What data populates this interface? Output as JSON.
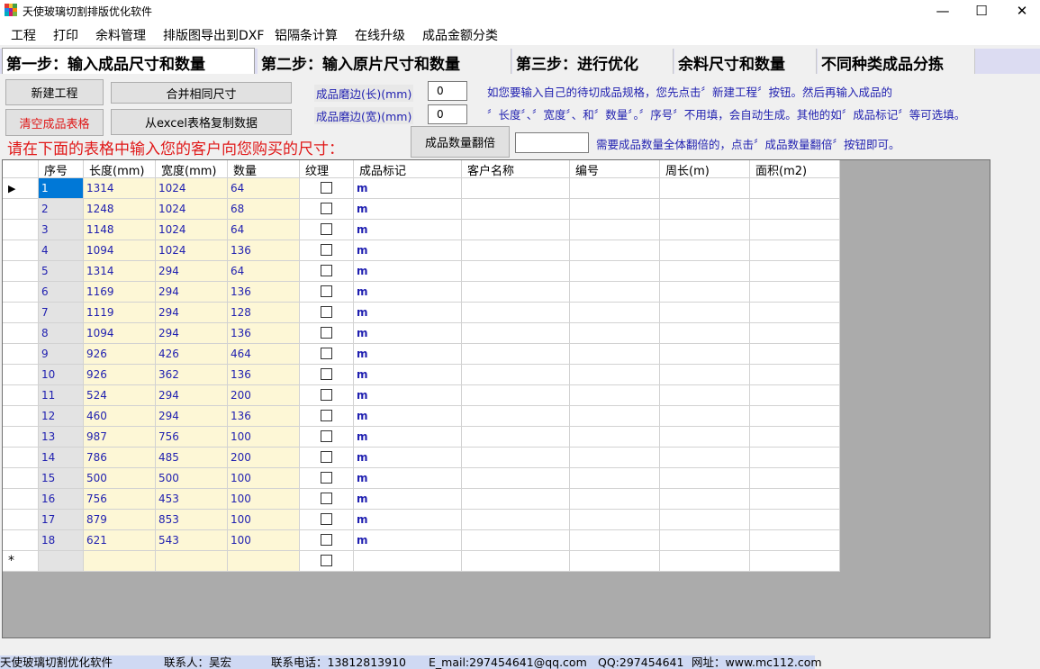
{
  "window": {
    "title": "天使玻璃切割排版优化软件",
    "minimize": "—",
    "maximize": "☐",
    "close": "✕"
  },
  "menu": [
    "工程",
    "打印",
    "余料管理",
    "排版图导出到DXF",
    "铝隔条计算",
    "在线升级",
    "成品金额分类"
  ],
  "tabs": [
    "第一步：输入成品尺寸和数量",
    "第二步：输入原片尺寸和数量",
    "第三步：进行优化",
    "余料尺寸和数量",
    "不同种类成品分拣"
  ],
  "toolbar": {
    "new_project": "新建工程",
    "merge_same": "合并相同尺寸",
    "clear_table": "清空成品表格",
    "copy_excel": "从excel表格复制数据",
    "edge_len_label": "成品磨边(长)(mm)",
    "edge_len_value": "0",
    "edge_wid_label": "成品磨边(宽)(mm)",
    "edge_wid_value": "0",
    "multiply_button": "成品数量翻倍",
    "multiply_value": ""
  },
  "instructions": {
    "line1": "如您要输入自己的待切成品规格，您先点击〞新建工程〞按钮。然后再输入成品的",
    "line2": "〞长度〞、〞宽度〞、和〞数量〞。〞序号〞不用填，会自动生成。其他的如〞成品标记〞等可选填。",
    "multiply_hint": "需要成品数量全体翻倍的，点击〞成品数量翻倍〞按钮即可。",
    "red_prompt": "请在下面的表格中输入您的客户向您购买的尺寸："
  },
  "colors": {
    "selected_cell": "#0078d7",
    "input_column_bg": "#fdf7d6",
    "index_column_bg": "#e3e3e3",
    "blue_text": "#1f1fb0",
    "red_text": "#e01818",
    "status_bg": "#cfd9f3"
  },
  "table": {
    "columns": [
      "序号",
      "长度(mm)",
      "宽度(mm)",
      "数量",
      "纹理",
      "成品标记",
      "客户名称",
      "编号",
      "周长(m)",
      "面积(m2)"
    ],
    "current_row_indicator": "▶",
    "new_row_indicator": "*",
    "rows": [
      {
        "idx": "1",
        "len": "1314",
        "wid": "1024",
        "qty": "64",
        "mark": "m"
      },
      {
        "idx": "2",
        "len": "1248",
        "wid": "1024",
        "qty": "68",
        "mark": "m"
      },
      {
        "idx": "3",
        "len": "1148",
        "wid": "1024",
        "qty": "64",
        "mark": "m"
      },
      {
        "idx": "4",
        "len": "1094",
        "wid": "1024",
        "qty": "136",
        "mark": "m"
      },
      {
        "idx": "5",
        "len": "1314",
        "wid": "294",
        "qty": "64",
        "mark": "m"
      },
      {
        "idx": "6",
        "len": "1169",
        "wid": "294",
        "qty": "136",
        "mark": "m"
      },
      {
        "idx": "7",
        "len": "1119",
        "wid": "294",
        "qty": "128",
        "mark": "m"
      },
      {
        "idx": "8",
        "len": "1094",
        "wid": "294",
        "qty": "136",
        "mark": "m"
      },
      {
        "idx": "9",
        "len": "926",
        "wid": "426",
        "qty": "464",
        "mark": "m"
      },
      {
        "idx": "10",
        "len": "926",
        "wid": "362",
        "qty": "136",
        "mark": "m"
      },
      {
        "idx": "11",
        "len": "524",
        "wid": "294",
        "qty": "200",
        "mark": "m"
      },
      {
        "idx": "12",
        "len": "460",
        "wid": "294",
        "qty": "136",
        "mark": "m"
      },
      {
        "idx": "13",
        "len": "987",
        "wid": "756",
        "qty": "100",
        "mark": "m"
      },
      {
        "idx": "14",
        "len": "786",
        "wid": "485",
        "qty": "200",
        "mark": "m"
      },
      {
        "idx": "15",
        "len": "500",
        "wid": "500",
        "qty": "100",
        "mark": "m"
      },
      {
        "idx": "16",
        "len": "756",
        "wid": "453",
        "qty": "100",
        "mark": "m"
      },
      {
        "idx": "17",
        "len": "879",
        "wid": "853",
        "qty": "100",
        "mark": "m"
      },
      {
        "idx": "18",
        "len": "621",
        "wid": "543",
        "qty": "100",
        "mark": "m"
      }
    ]
  },
  "status": {
    "app_name": "天使玻璃切割优化软件",
    "contact": "联系人：吴宏",
    "phone": "联系电话：13812813910",
    "email": "E_mail:297454641@qq.com",
    "qq": "QQ:297454641",
    "website": "网址：www.mc112.com"
  }
}
